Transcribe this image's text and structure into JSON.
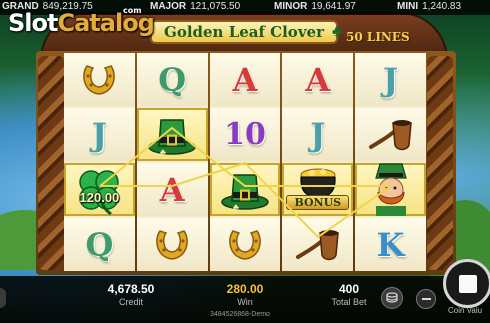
{
  "jackpots": {
    "grand": {
      "label": "GRAND",
      "value": "849,219.75"
    },
    "major": {
      "label": "MAJOR",
      "value": "121,075.50"
    },
    "minor": {
      "label": "MINOR",
      "value": "19,641.97"
    },
    "mini": {
      "label": "MINI",
      "value": "1,240.83"
    }
  },
  "watermark": {
    "part1": "Slot",
    "part2": "Catalog",
    "com": "com"
  },
  "game": {
    "title": "Golden Leaf Clover",
    "lines": "50 LINES"
  },
  "reels": [
    [
      {
        "type": "horseshoe",
        "icon": "horseshoe-icon"
      },
      {
        "type": "letter",
        "text": "J",
        "cls": "sym-j"
      },
      {
        "type": "cash",
        "text": "120.00",
        "icon": "clover-icon",
        "win": true
      },
      {
        "type": "letter",
        "text": "Q",
        "cls": "sym-q"
      }
    ],
    [
      {
        "type": "letter",
        "text": "Q",
        "cls": "sym-q"
      },
      {
        "type": "hat",
        "icon": "leprechaun-hat-icon",
        "win": true
      },
      {
        "type": "letter",
        "text": "A",
        "cls": "sym-a"
      },
      {
        "type": "horseshoe",
        "icon": "horseshoe-icon"
      }
    ],
    [
      {
        "type": "letter",
        "text": "A",
        "cls": "sym-a"
      },
      {
        "type": "letter",
        "text": "10",
        "cls": "sym-10"
      },
      {
        "type": "hat",
        "icon": "leprechaun-hat-icon",
        "win": true
      },
      {
        "type": "horseshoe",
        "icon": "horseshoe-icon"
      }
    ],
    [
      {
        "type": "letter",
        "text": "A",
        "cls": "sym-a"
      },
      {
        "type": "letter",
        "text": "J",
        "cls": "sym-j"
      },
      {
        "type": "bonus",
        "text": "BONUS",
        "icon": "pot-of-gold-icon",
        "win": true
      },
      {
        "type": "pipe",
        "icon": "pipe-icon"
      }
    ],
    [
      {
        "type": "letter",
        "text": "J",
        "cls": "sym-j"
      },
      {
        "type": "pipe",
        "icon": "pipe-icon"
      },
      {
        "type": "wild",
        "icon": "leprechaun-icon",
        "win": true
      },
      {
        "type": "letter",
        "text": "K",
        "cls": "sym-k"
      }
    ]
  ],
  "bottom": {
    "credit_value": "4,678.50",
    "credit_label": "Credit",
    "win_value": "280.00",
    "win_label": "Win",
    "bet_value": "400",
    "bet_label": "Total Bet",
    "build": "3484526868-Demo",
    "coin_value_label": "Coin Valu"
  },
  "colors": {
    "win_value": "#f6c233",
    "logo_text": "#1a5d1e",
    "lines_text": "#f6d24b"
  }
}
